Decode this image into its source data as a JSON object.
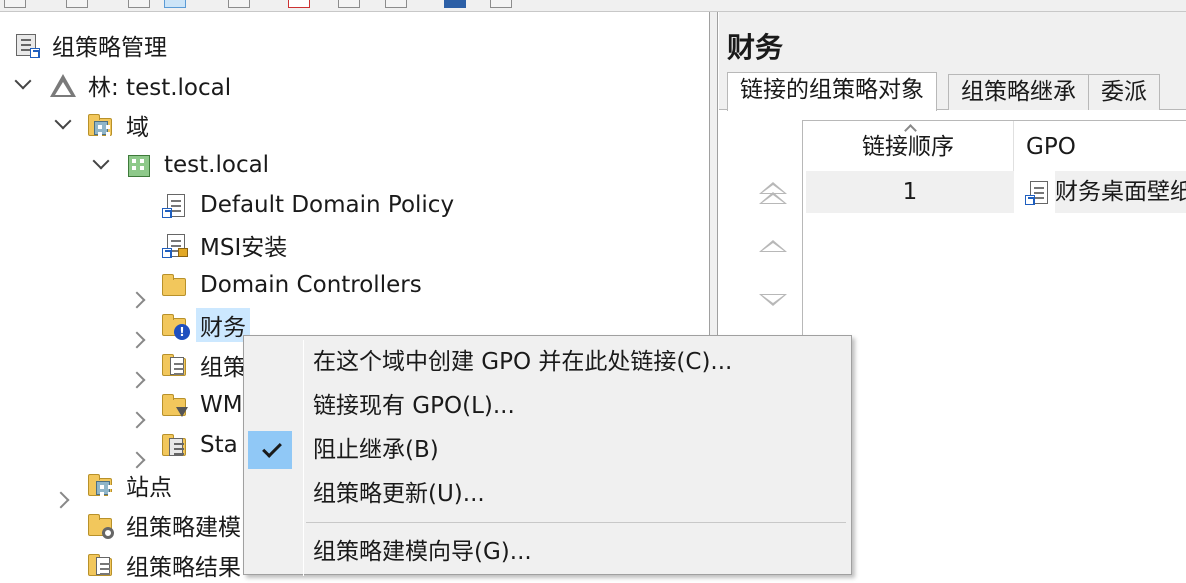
{
  "tree": {
    "root": "组策略管理",
    "forest": "林: test.local",
    "domains": "域",
    "domain": "test.local",
    "default_policy": "Default Domain Policy",
    "msi_policy": "MSI安装",
    "domain_controllers": "Domain Controllers",
    "ou_finance": "财务",
    "ou_group_partial": "组策",
    "ou_wmi_partial": "WM",
    "ou_starter_partial": "Sta",
    "sites": "站点",
    "modeling_partial": "组策略建模",
    "results_partial": "组策略结果"
  },
  "right_pane": {
    "title": "财务",
    "tabs": [
      "链接的组策略对象",
      "组策略继承",
      "委派"
    ],
    "columns": [
      "链接顺序",
      "GPO"
    ],
    "rows": [
      {
        "order": "1",
        "gpo": "财务桌面壁纸"
      }
    ]
  },
  "context_menu": {
    "items": [
      "在这个域中创建 GPO 并在此处链接(C)...",
      "链接现有 GPO(L)...",
      "阻止继承(B)",
      "组策略更新(U)...",
      "组策略建模向导(G)..."
    ],
    "checked_item": "阻止继承(B)"
  },
  "icons": {
    "root": "gpm-console-icon",
    "forest": "forest-icon",
    "domains": "domains-folder-icon",
    "domain": "domain-icon",
    "gpo_link": "gpo-link-icon",
    "ou": "ou-folder-icon",
    "check": "checkmark-icon"
  },
  "colors": {
    "selection": "#cce8ff",
    "menu_check_bg": "#90c8f6",
    "menu_bg": "#f0f0f0"
  }
}
